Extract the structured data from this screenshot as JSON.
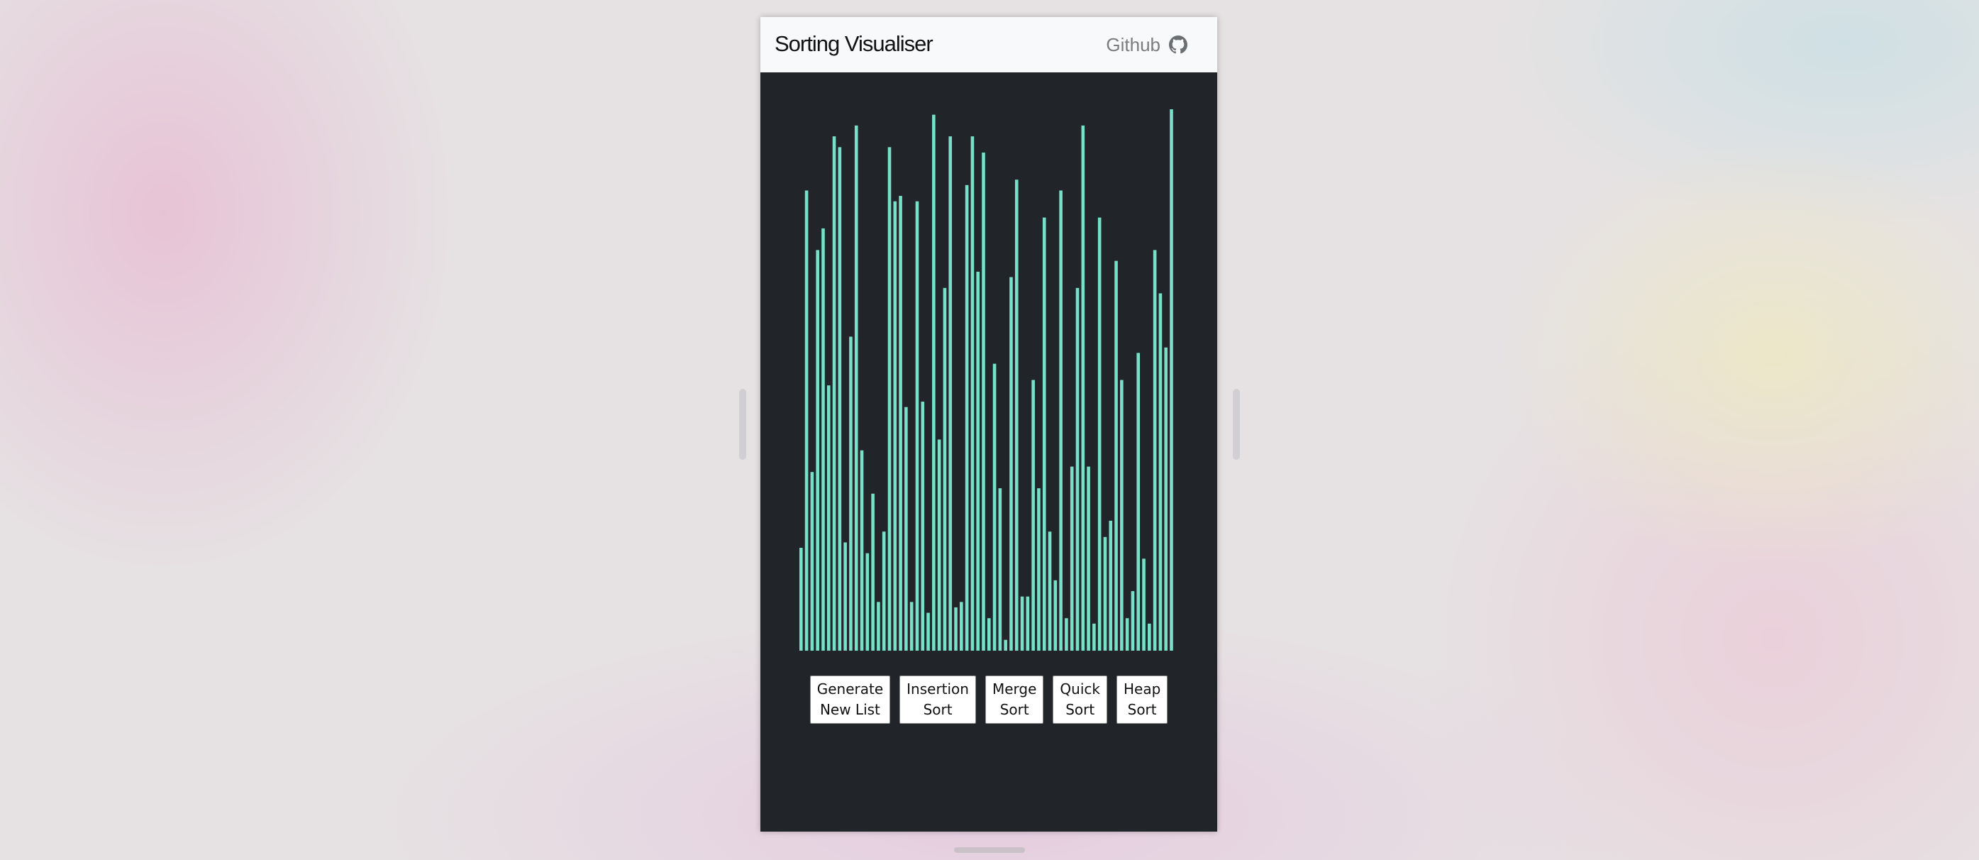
{
  "navbar": {
    "brand": "Sorting Visualiser",
    "github_label": "Github",
    "github_icon": "github-icon"
  },
  "colors": {
    "bar": "#77e0c9",
    "background": "#212529",
    "navbar": "#f8f9fa"
  },
  "chart_data": {
    "type": "bar",
    "ylim": [
      0,
      100
    ],
    "values": [
      19,
      85,
      33,
      74,
      78,
      49,
      95,
      93,
      20,
      58,
      97,
      37,
      18,
      29,
      9,
      22,
      93,
      83,
      84,
      45,
      9,
      83,
      46,
      7,
      99,
      39,
      67,
      95,
      8,
      9,
      86,
      95,
      70,
      92,
      6,
      53,
      30,
      2,
      69,
      87,
      10,
      10,
      50,
      30,
      80,
      22,
      13,
      85,
      6,
      34,
      67,
      97,
      34,
      5,
      80,
      21,
      24,
      72,
      50,
      6,
      11,
      55,
      17,
      5,
      74,
      66,
      56,
      100
    ]
  },
  "buttons": [
    {
      "label": "Generate\nNew List"
    },
    {
      "label": "Insertion\nSort"
    },
    {
      "label": "Merge\nSort"
    },
    {
      "label": "Quick\nSort"
    },
    {
      "label": "Heap\nSort"
    }
  ]
}
